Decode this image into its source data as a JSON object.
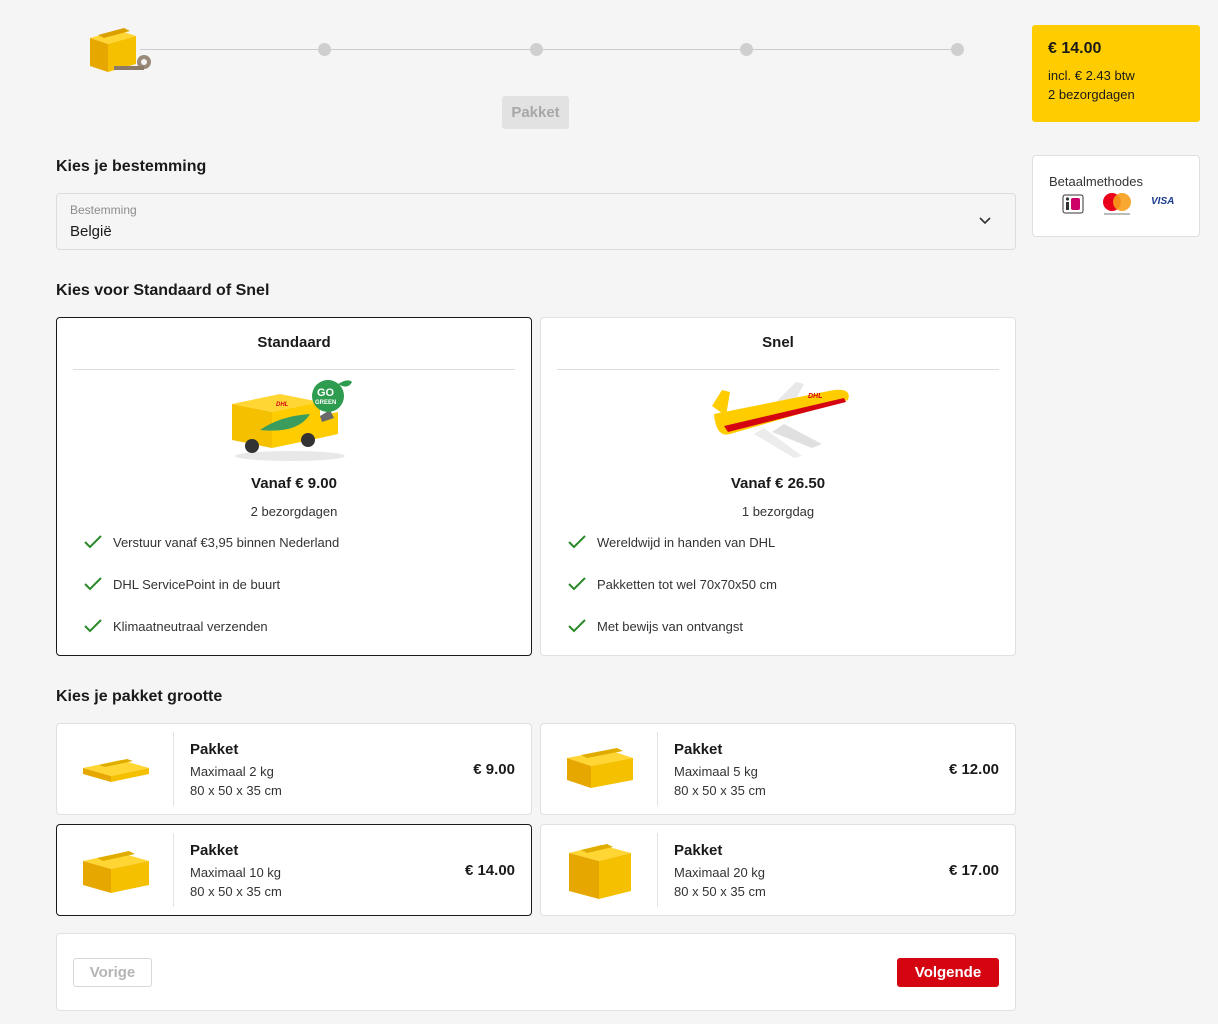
{
  "progress": {
    "current_step_label": "Pakket",
    "total_steps": 5,
    "current_step": 1
  },
  "destination": {
    "section_title": "Kies je bestemming",
    "field_label": "Bestemming",
    "value": "België"
  },
  "service": {
    "section_title": "Kies voor Standaard of Snel",
    "options": [
      {
        "name": "Standaard",
        "price": "Vanaf € 9.00",
        "days": "2 bezorgdagen",
        "badge": "GO GREEN",
        "features": [
          "Verstuur vanaf €3,95 binnen Nederland",
          "DHL ServicePoint in de buurt",
          "Klimaatneutraal verzenden"
        ],
        "selected": true
      },
      {
        "name": "Snel",
        "price": "Vanaf € 26.50",
        "days": "1 bezorgdag",
        "features": [
          "Wereldwijd in handen van DHL",
          "Pakketten tot wel 70x70x50 cm",
          "Met bewijs van ontvangst"
        ],
        "selected": false
      }
    ]
  },
  "packages": {
    "section_title": "Kies je pakket grootte",
    "items": [
      {
        "title": "Pakket",
        "weight": "Maximaal 2 kg",
        "dims": "80 x 50 x 35 cm",
        "price": "€ 9.00",
        "selected": false
      },
      {
        "title": "Pakket",
        "weight": "Maximaal 5 kg",
        "dims": "80 x 50 x 35 cm",
        "price": "€ 12.00",
        "selected": false
      },
      {
        "title": "Pakket",
        "weight": "Maximaal 10 kg",
        "dims": "80 x 50 x 35 cm",
        "price": "€ 14.00",
        "selected": true
      },
      {
        "title": "Pakket",
        "weight": "Maximaal 20 kg",
        "dims": "80 x 50 x 35 cm",
        "price": "€ 17.00",
        "selected": false
      }
    ]
  },
  "nav": {
    "prev_label": "Vorige",
    "next_label": "Volgende"
  },
  "summary": {
    "total": "€ 14.00",
    "vat": "incl. € 2.43 btw",
    "days": "2 bezorgdagen"
  },
  "payment": {
    "title": "Betaalmethodes",
    "methods": [
      "ideal-icon",
      "mastercard-icon",
      "visa-icon"
    ],
    "visa_text": "VISA"
  },
  "colors": {
    "dhl_yellow": "#ffcc00",
    "dhl_red": "#d40511",
    "check_green": "#2a8a2a"
  }
}
